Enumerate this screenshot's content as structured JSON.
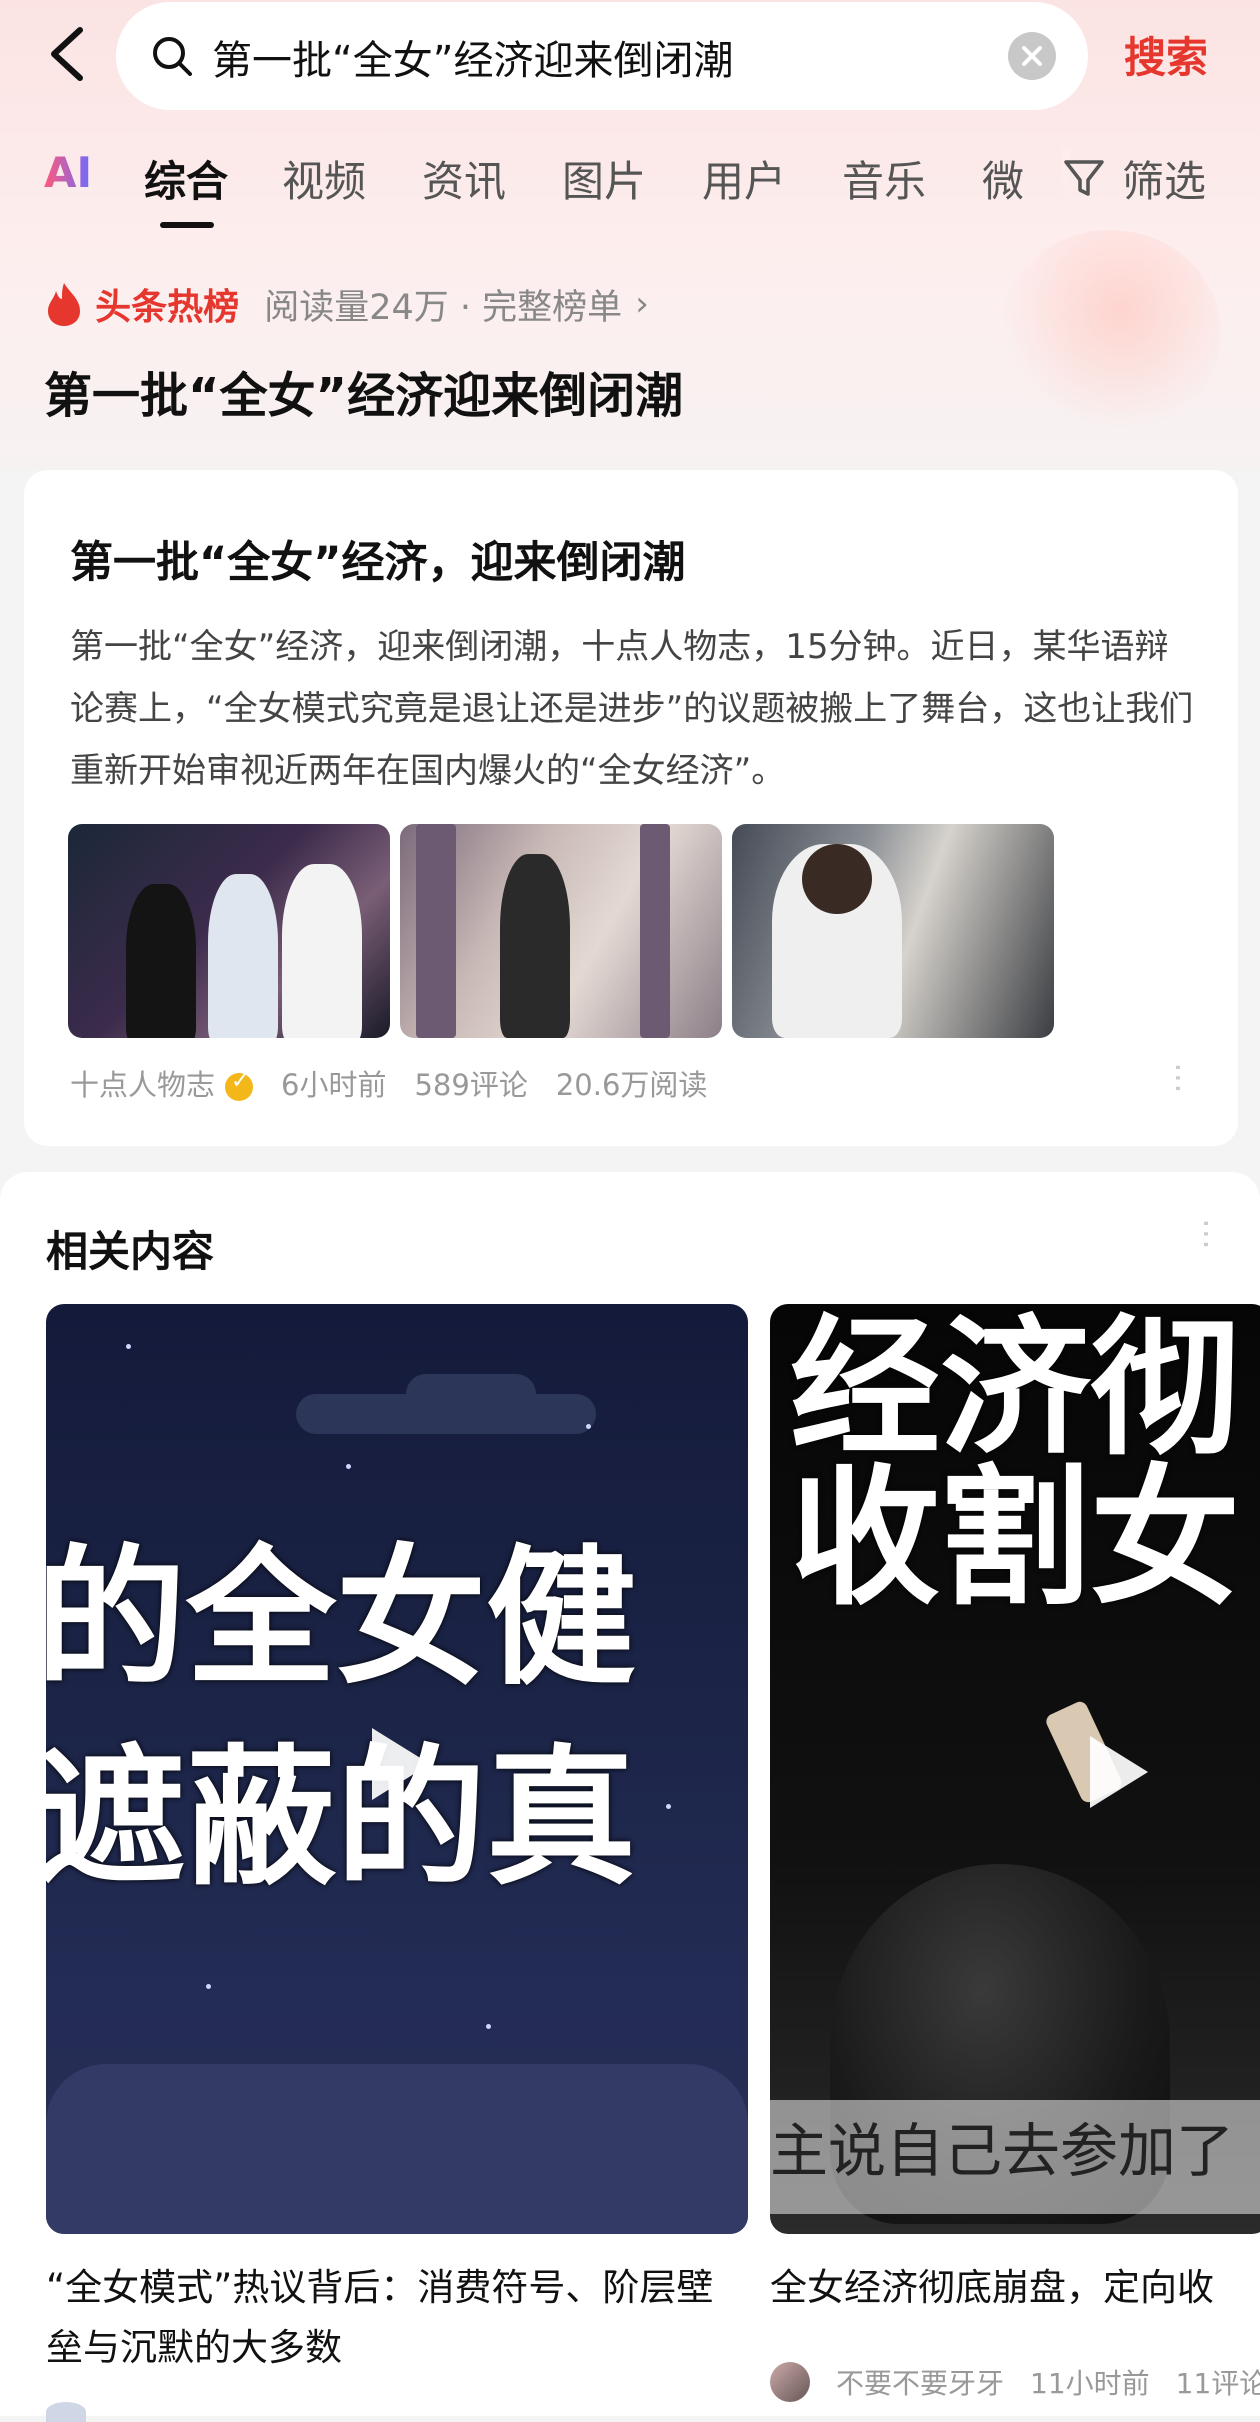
{
  "search": {
    "query": "第一批“全女”经济迎来倒闭潮",
    "button": "搜索"
  },
  "tabs": [
    "AI",
    "综合",
    "视频",
    "资讯",
    "图片",
    "用户",
    "音乐",
    "微"
  ],
  "filter_label": "筛选",
  "hot": {
    "badge": "头条热榜",
    "meta": "阅读量24万 · 完整榜单",
    "title": "第一批“全女”经济迎来倒闭潮"
  },
  "article": {
    "title": "第一批“全女”经济，迎来倒闭潮",
    "body": "第一批“全女”经济，迎来倒闭潮，十点人物志，15分钟。近日，某华语辩论赛上，“全女模式究竟是退让还是进步”的议题被搬上了舞台，这也让我们重新开始审视近两年在国内爆火的“全女经济”。",
    "source": "十点人物志",
    "time": "6小时前",
    "comments": "589评论",
    "reads": "20.6万阅读"
  },
  "related": {
    "title": "相关内容",
    "videos": [
      {
        "overlay_line1": "的全女健",
        "overlay_line2": "遮蔽的真",
        "title": "“全女模式”热议背后：消费符号、阶层壁垒与沉默的大多数"
      },
      {
        "overlay_line1": "经济彻",
        "overlay_line2": "收割女",
        "caption": "主说自己去参加了",
        "title": "全女经济彻底崩盘，定向收",
        "author": "不要不要牙牙",
        "time": "11小时前",
        "comments": "11评论"
      }
    ]
  },
  "colors": {
    "accent": "#e5372e",
    "gold_badge": "#f3b71a"
  }
}
